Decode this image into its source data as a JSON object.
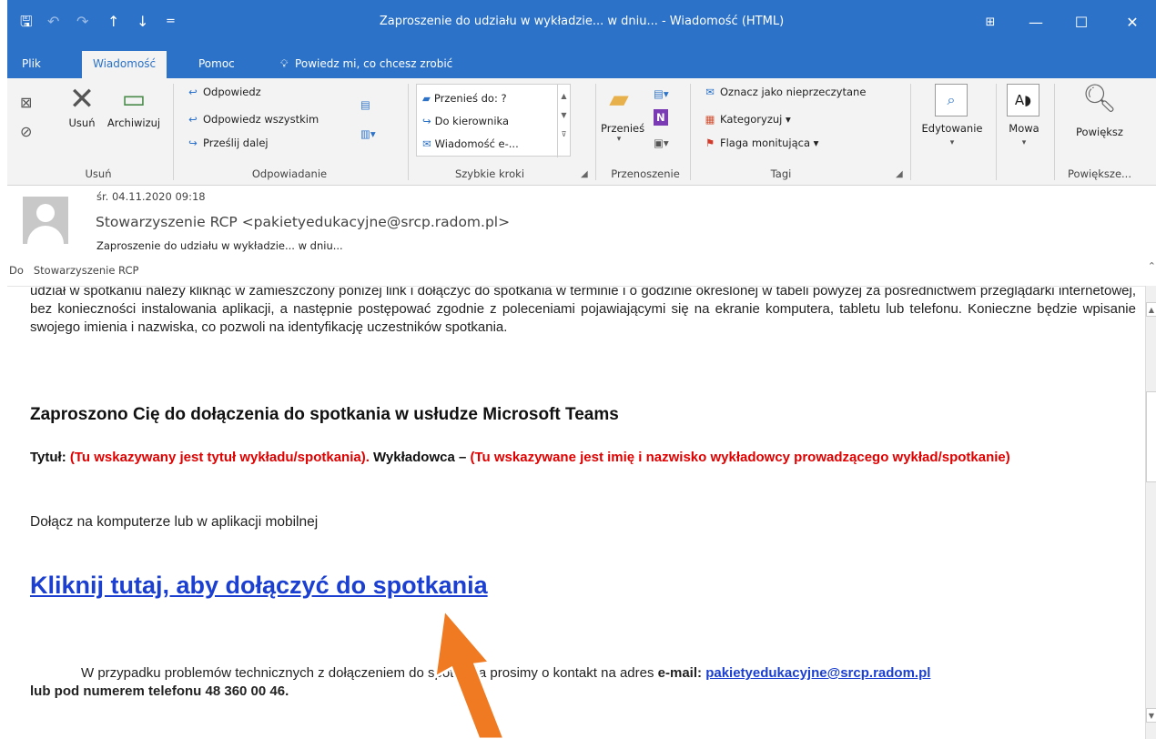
{
  "window": {
    "title": "Zaproszenie do udziału w wykładzie... w dniu... - Wiadomość (HTML)",
    "qat_icons": [
      "save-icon",
      "undo-icon",
      "redo-icon",
      "up-arrow-icon",
      "down-arrow-icon",
      "customize-icon"
    ]
  },
  "tabs": [
    {
      "label": "Plik"
    },
    {
      "label": "Wiadomość"
    },
    {
      "label": "Pomoc"
    }
  ],
  "tellme": "Powiedz mi, co chcesz zrobić",
  "ribbon": {
    "delete": {
      "label": "Usuń",
      "delete_btn": "Usuń",
      "archive_btn": "Archiwizuj"
    },
    "respond": {
      "label": "Odpowiadanie",
      "reply": "Odpowiedz",
      "reply_all": "Odpowiedz wszystkim",
      "forward": "Prześlij dalej"
    },
    "quicksteps": {
      "label": "Szybkie kroki",
      "items": [
        "Przenieś do: ?",
        "Do kierownika",
        "Wiadomość e-..."
      ]
    },
    "move": {
      "label": "Przenoszenie",
      "move_btn": "Przenieś"
    },
    "tags": {
      "label": "Tagi",
      "unread": "Oznacz jako nieprzeczytane",
      "categorize": "Kategoryzuj",
      "flag": "Flaga monitująca"
    },
    "editing": {
      "label": "Edytowanie"
    },
    "speech": {
      "label": "Mowa"
    },
    "zoom": {
      "label": "Powiększ",
      "group_label": "Powiększe..."
    }
  },
  "header": {
    "date": "śr. 04.11.2020 09:18",
    "sender": "Stowarzyszenie RCP <pakietyedukacyjne@srcp.radom.pl>",
    "subject": "Zaproszenie do udziału w wykładzie... w dniu...",
    "to_label": "Do",
    "to": "Stowarzyszenie RCP"
  },
  "body": {
    "para_cut": "udział w spotkaniu należy kliknąć w zamieszczony poniżej link i dołączyć do spotkania w terminie i o godzinie określonej w tabeli powyżej za pośrednictwem przeglądarki internetowej, bez konieczności instalowania aplikacji, a następnie postępować zgodnie z poleceniami pojawiającymi się na ekranie komputera, tabletu lub telefonu. Konieczne będzie wpisanie swojego imienia i nazwiska, co pozwoli na identyfikację uczestników spotkania.",
    "teams_title": "Zaproszono Cię do dołączenia do spotkania w usłudze Microsoft Teams",
    "tytul_label": "Tytuł:",
    "tytul_value": "(Tu wskazywany jest tytuł wykładu/spotkania).",
    "wykladowca_label": "Wykładowca –",
    "wykladowca_value": "(Tu wskazywane jest imię i nazwisko wykładowcy prowadzącego wykład/spotkanie)",
    "dolacz": "Dołącz na komputerze lub w aplikacji mobilnej",
    "join_link": "Kliknij tutaj, aby dołączyć do spotkania",
    "problem_text": "W przypadku problemów technicznych z dołączeniem do spotkania prosimy o kontakt na adres",
    "email_label": "e-mail:",
    "email": "pakietyedukacyjne@srcp.radom.pl",
    "phone_text": "lub pod numerem telefonu 48 360 00 46."
  },
  "colors": {
    "accent": "#2b72c8",
    "link": "#1a3fd1",
    "red": "#e00000",
    "annotation_arrow": "#f07a22"
  }
}
